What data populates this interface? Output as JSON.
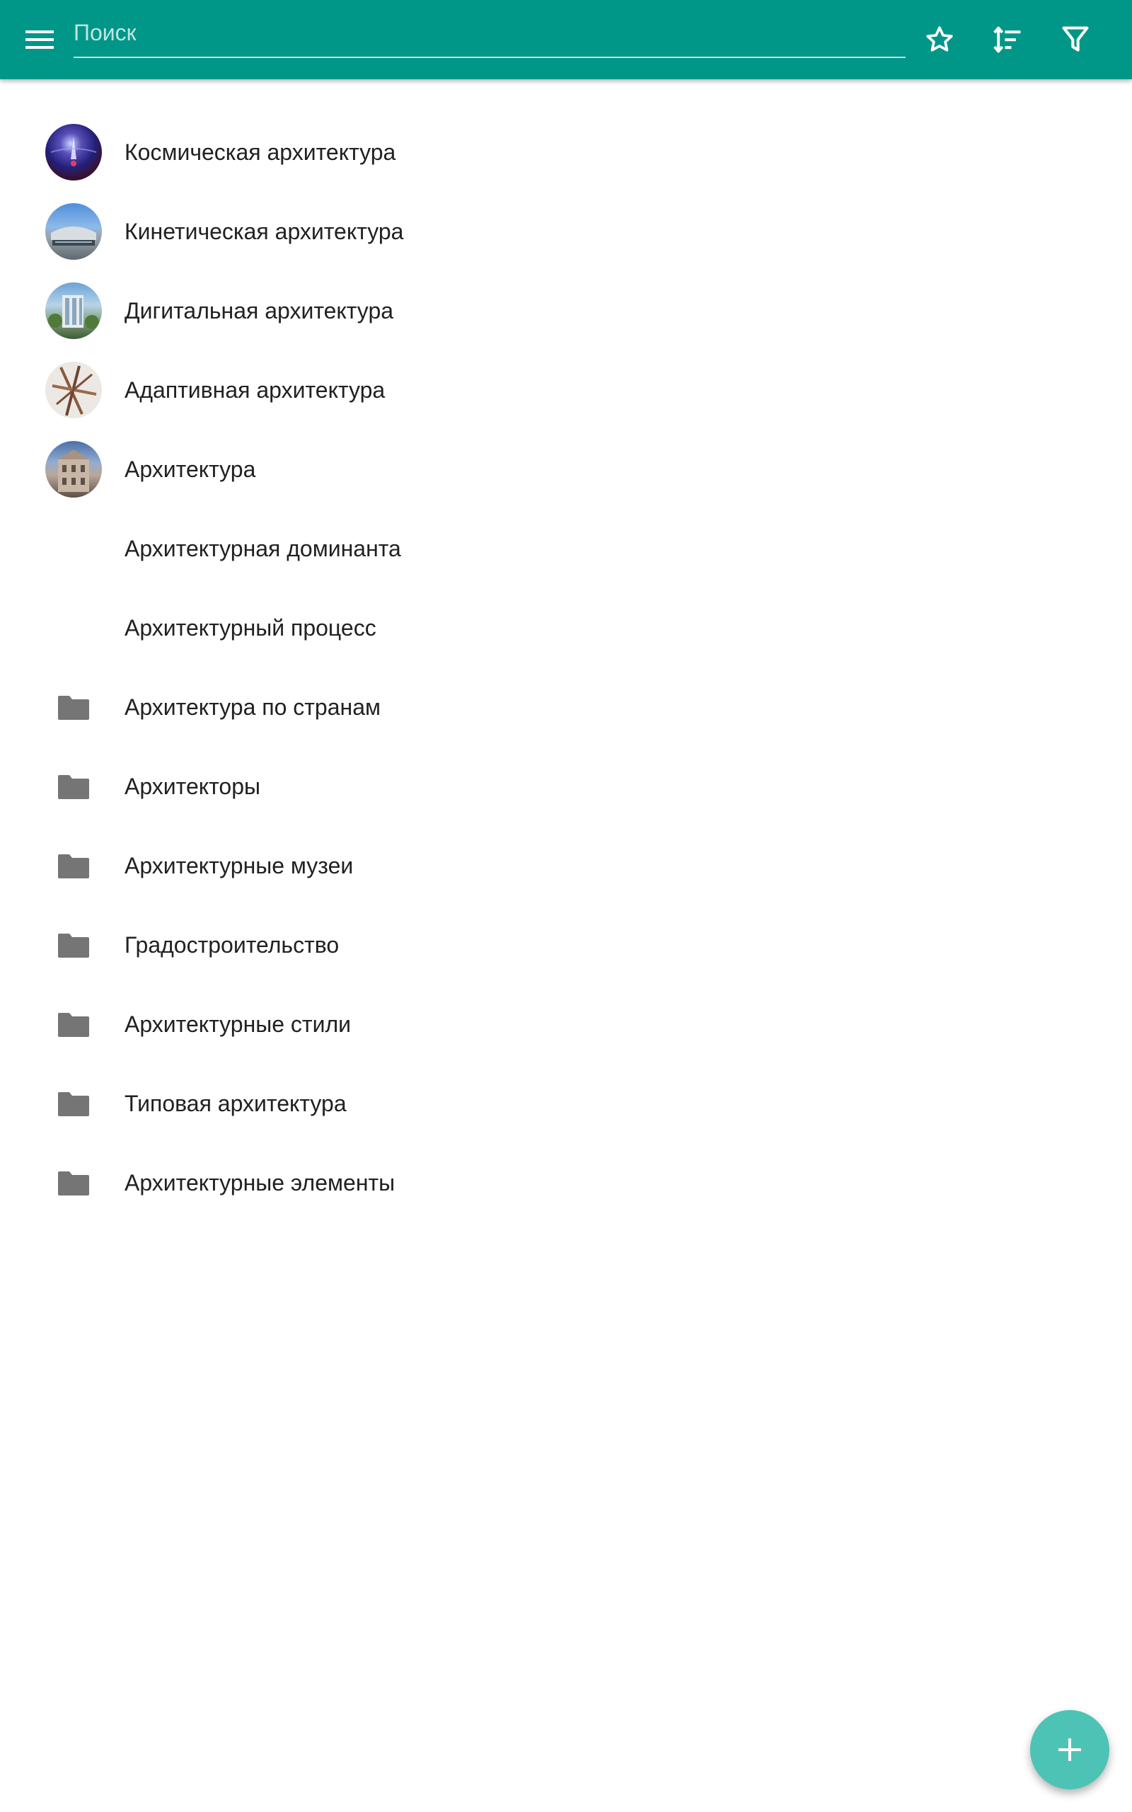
{
  "toolbar": {
    "search": {
      "placeholder": "Поиск",
      "value": ""
    },
    "icons": [
      "menu-icon",
      "star-icon",
      "sort-icon",
      "filter-icon"
    ]
  },
  "colors": {
    "primary": "#009688",
    "fab": "#4dc3b5",
    "folder_icon": "#757575",
    "text": "#212121"
  },
  "list": {
    "items": [
      {
        "label": "Космическая архитектура",
        "icon": "image"
      },
      {
        "label": "Кинетическая архитектура",
        "icon": "image"
      },
      {
        "label": "Дигитальная архитектура",
        "icon": "image"
      },
      {
        "label": "Адаптивная архитектура",
        "icon": "image"
      },
      {
        "label": "Архитектура",
        "icon": "image"
      },
      {
        "label": "Архитектурная доминанта",
        "icon": "none"
      },
      {
        "label": "Архитектурный процесс",
        "icon": "none"
      },
      {
        "label": "Архитектура по странам",
        "icon": "folder"
      },
      {
        "label": "Архитекторы",
        "icon": "folder"
      },
      {
        "label": "Архитектурные музеи",
        "icon": "folder"
      },
      {
        "label": "Градостроительство",
        "icon": "folder"
      },
      {
        "label": "Архитектурные стили",
        "icon": "folder"
      },
      {
        "label": "Типовая архитектура",
        "icon": "folder"
      },
      {
        "label": "Архитектурные элементы",
        "icon": "folder"
      }
    ]
  },
  "fab": {
    "icon": "plus-icon"
  }
}
